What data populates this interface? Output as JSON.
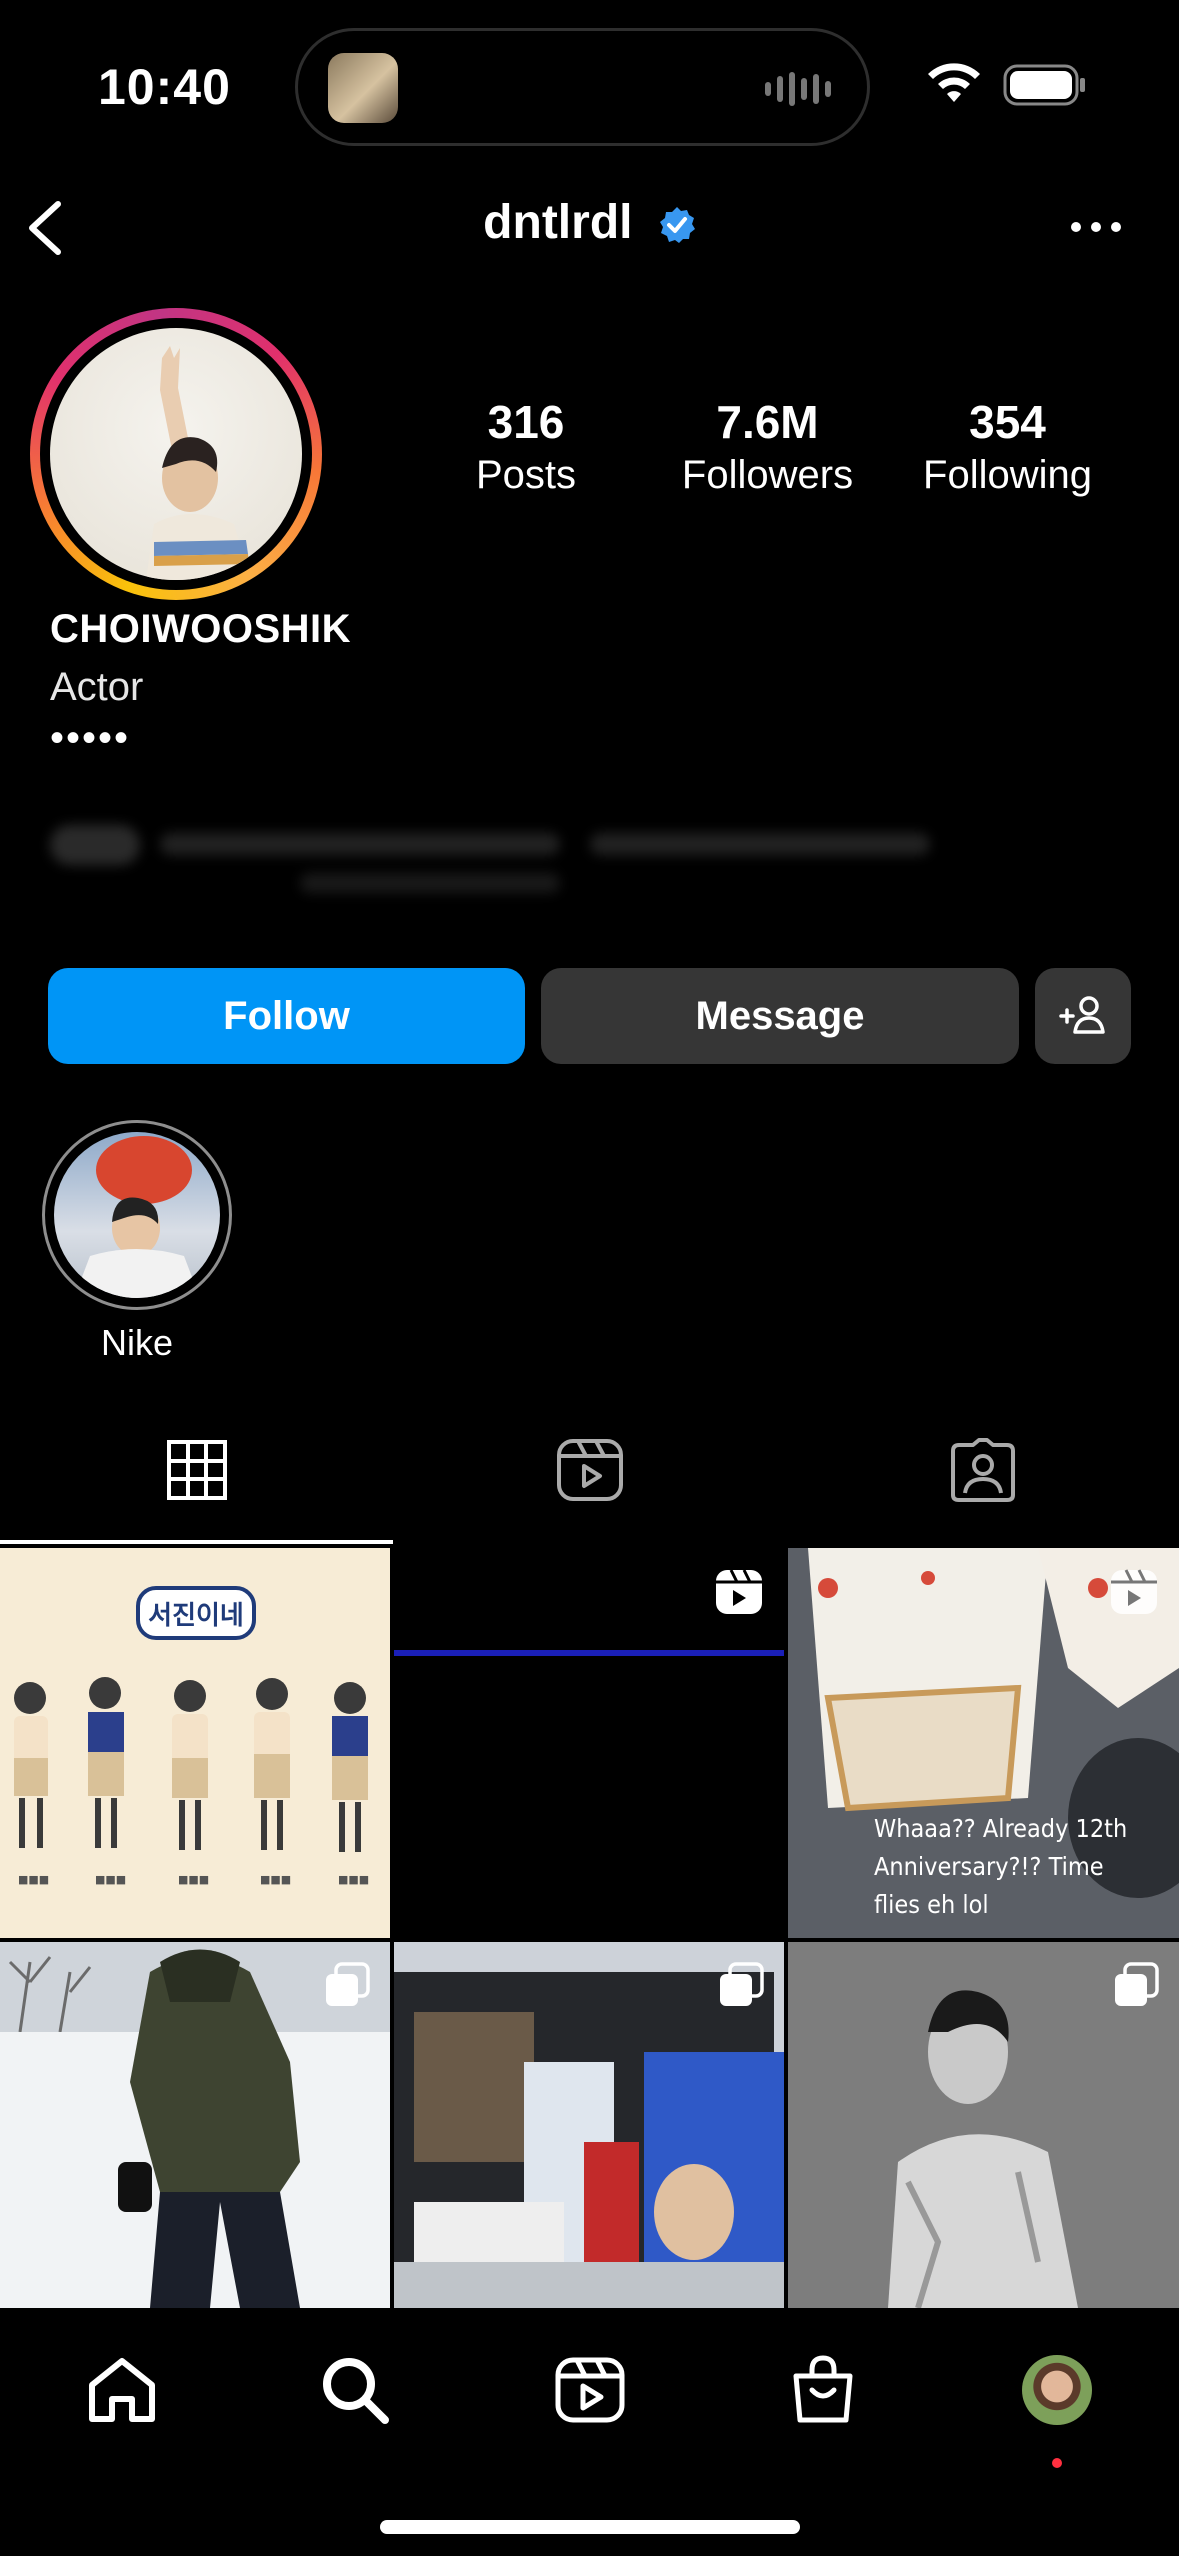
{
  "status_bar": {
    "time": "10:40"
  },
  "header": {
    "username": "dntlrdl",
    "verified": true
  },
  "profile": {
    "stats": [
      {
        "value": "316",
        "label": "Posts"
      },
      {
        "value": "7.6M",
        "label": "Followers"
      },
      {
        "value": "354",
        "label": "Following"
      }
    ],
    "name": "CHOIWOOSHIK",
    "category": "Actor",
    "bio_more": "•••••"
  },
  "actions": {
    "follow": "Follow",
    "message": "Message"
  },
  "highlights": [
    {
      "label": "Nike"
    }
  ],
  "tabs": [
    "grid-tab",
    "reels-tab",
    "tagged-tab"
  ],
  "posts": [
    {
      "type": "reel",
      "caption": ""
    },
    {
      "type": "reel",
      "caption": ""
    },
    {
      "type": "reel",
      "caption": "Whaaa?? Already 12th Anniversary?!? Time flies eh lol"
    },
    {
      "type": "carousel",
      "caption": ""
    },
    {
      "type": "carousel",
      "caption": ""
    },
    {
      "type": "carousel",
      "caption": ""
    }
  ],
  "post1_title": "서진이네",
  "colors": {
    "accent": "#0095f6",
    "button_dark": "#363636",
    "verified": "#3897f0",
    "notification": "#ff3040"
  }
}
